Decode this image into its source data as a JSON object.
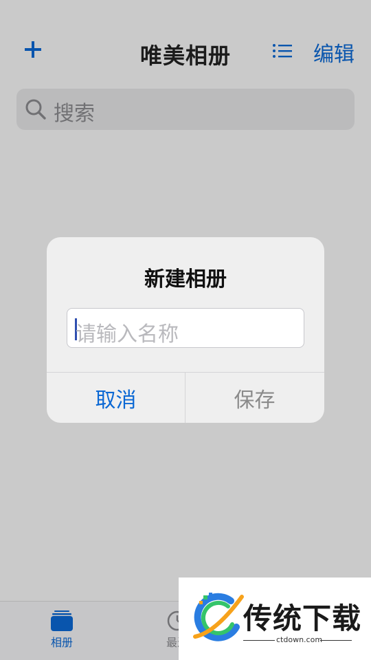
{
  "header": {
    "title": "唯美相册",
    "edit_label": "编辑",
    "add_icon": "plus-icon",
    "list_icon": "list-icon"
  },
  "search": {
    "placeholder": "搜索",
    "icon": "search-icon"
  },
  "dialog": {
    "title": "新建相册",
    "input_placeholder": "请输入名称",
    "input_value": "",
    "cancel_label": "取消",
    "save_label": "保存"
  },
  "tabbar": {
    "tabs": [
      {
        "label": "相册",
        "icon": "albums-icon",
        "active": true
      },
      {
        "label": "最近",
        "icon": "clock-icon",
        "active": false
      }
    ]
  },
  "watermark": {
    "brand": "传统下载",
    "url": "ctdown.com"
  },
  "colors": {
    "accent": "#0b68d4",
    "background": "#f7f7f7",
    "dialog_background": "#efefef",
    "disabled_text": "#8a8a8a"
  }
}
